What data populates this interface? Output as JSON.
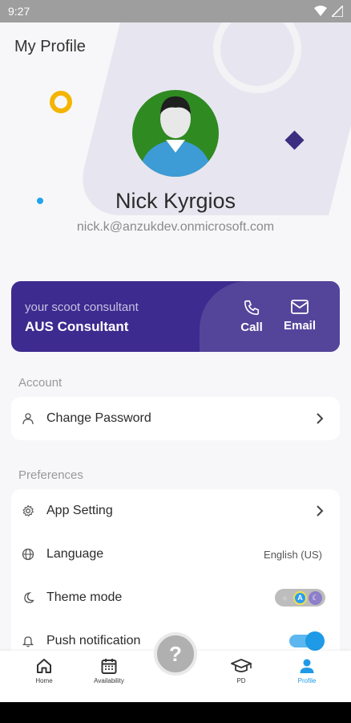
{
  "status_bar": {
    "time": "9:27"
  },
  "header": {
    "title": "My Profile"
  },
  "profile": {
    "name": "Nick Kyrgios",
    "email": "nick.k@anzukdev.onmicrosoft.com"
  },
  "consultant": {
    "subtitle": "your scoot consultant",
    "name": "AUS Consultant",
    "call_label": "Call",
    "email_label": "Email"
  },
  "account": {
    "section_title": "Account",
    "items": [
      {
        "label": "Change Password",
        "icon": "person-icon"
      }
    ]
  },
  "preferences": {
    "section_title": "Preferences",
    "items": [
      {
        "label": "App Setting",
        "icon": "gear-icon"
      },
      {
        "label": "Language",
        "icon": "globe-icon",
        "value": "English (US)"
      },
      {
        "label": "Theme mode",
        "icon": "moon-icon"
      },
      {
        "label": "Push notification",
        "icon": "bell-icon",
        "enabled": true
      }
    ]
  },
  "bottom_nav": {
    "items": [
      {
        "label": "Home",
        "icon": "home-icon"
      },
      {
        "label": "Availability",
        "icon": "calendar-icon"
      },
      {
        "label": "PD",
        "icon": "graduation-cap-icon"
      },
      {
        "label": "Profile",
        "icon": "person-icon",
        "active": true
      }
    ],
    "help_label": "?"
  },
  "colors": {
    "brand_purple": "#3e2b8f",
    "accent_blue": "#1e9ae6",
    "avatar_green": "#2f8a22",
    "deco_yellow": "#f4b400"
  }
}
